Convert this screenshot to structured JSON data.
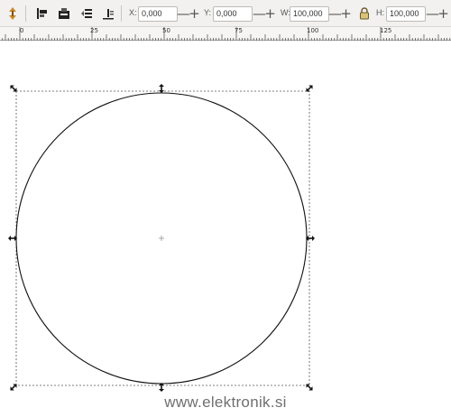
{
  "toolbar": {
    "x_label": "X:",
    "x_value": "0,000",
    "y_label": "Y:",
    "y_value": "0,000",
    "w_label": "W:",
    "w_value": "100,000",
    "h_label": "H:",
    "h_value": "100,000",
    "minus_symbol": "—",
    "plus_symbol": "+",
    "icons": [
      "transform-handle-icon",
      "align-left-icon",
      "align-bottom-icon",
      "raise-icon",
      "lower-icon",
      "lock-icon"
    ]
  },
  "ruler": {
    "labels": [
      "0",
      "25",
      "50",
      "75",
      "100",
      "125"
    ]
  },
  "canvas": {
    "object": "circle",
    "watermark": "www.elektronik.si"
  },
  "colors": {
    "toolbar_bg": "#f2f1f0",
    "selection_border": "#555555",
    "handle": "#111111"
  }
}
